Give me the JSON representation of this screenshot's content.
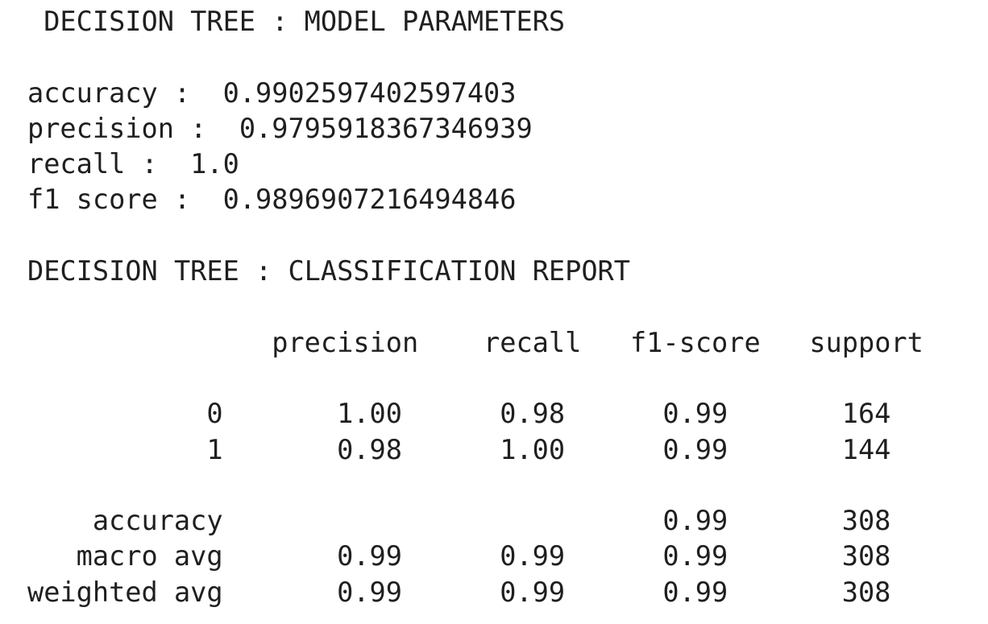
{
  "model_parameters": {
    "title": "DECISION TREE : MODEL PARAMETERS",
    "metrics": [
      {
        "label": "accuracy :",
        "value": "0.9902597402597403"
      },
      {
        "label": "precision :",
        "value": "0.9795918367346939"
      },
      {
        "label": "recall :",
        "value": "1.0"
      },
      {
        "label": "f1 score :",
        "value": "0.9896907216494846"
      }
    ]
  },
  "classification_report": {
    "title": "DECISION TREE : CLASSIFICATION REPORT",
    "headers": [
      "precision",
      "recall",
      "f1-score",
      "support"
    ],
    "class_rows": [
      {
        "label": "0",
        "precision": "1.00",
        "recall": "0.98",
        "f1": "0.99",
        "support": "164"
      },
      {
        "label": "1",
        "precision": "0.98",
        "recall": "1.00",
        "f1": "0.99",
        "support": "144"
      }
    ],
    "summary_rows": [
      {
        "label": "accuracy",
        "precision": "",
        "recall": "",
        "f1": "0.99",
        "support": "308"
      },
      {
        "label": "macro avg",
        "precision": "0.99",
        "recall": "0.99",
        "f1": "0.99",
        "support": "308"
      },
      {
        "label": "weighted avg",
        "precision": "0.99",
        "recall": "0.99",
        "f1": "0.99",
        "support": "308"
      }
    ]
  }
}
